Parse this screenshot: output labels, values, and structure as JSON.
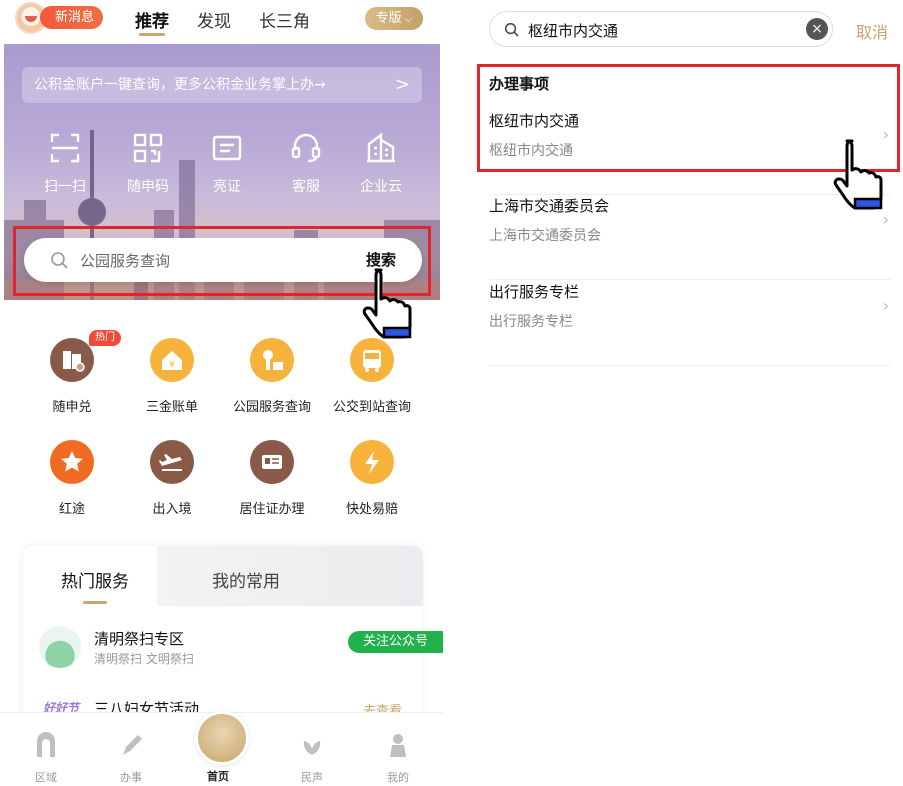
{
  "left": {
    "topbar": {
      "message_label": "新消息",
      "tabs": [
        "推荐",
        "发现",
        "长三角"
      ],
      "active_tab": "推荐",
      "edition_label": "专版"
    },
    "banner": {
      "notice_text": "公积金账户一键查询，更多公积金业务掌上办→",
      "notice_chevron": ">",
      "quick_actions": [
        {
          "label": "扫一扫",
          "icon": "scan-icon"
        },
        {
          "label": "随申码",
          "icon": "qr-code-icon"
        },
        {
          "label": "亮证",
          "icon": "id-card-icon"
        },
        {
          "label": "客服",
          "icon": "headset-icon"
        },
        {
          "label": "企业云",
          "icon": "building-icon"
        }
      ]
    },
    "search": {
      "placeholder": "公园服务查询",
      "button_label": "搜索"
    },
    "services": [
      {
        "label": "随申兑",
        "icon": "voucher-icon",
        "color": "#8a5a49",
        "badge": "热门"
      },
      {
        "label": "三金账单",
        "icon": "bill-icon",
        "color": "#f6b23a"
      },
      {
        "label": "公园服务查询",
        "icon": "park-icon",
        "color": "#f6b23a"
      },
      {
        "label": "公交到站查询",
        "icon": "bus-icon",
        "color": "#f6b23a"
      },
      {
        "label": "红途",
        "icon": "star-icon",
        "color": "#f06a22"
      },
      {
        "label": "出入境",
        "icon": "plane-icon",
        "color": "#8a5a49"
      },
      {
        "label": "居住证办理",
        "icon": "card-icon",
        "color": "#8a5a49"
      },
      {
        "label": "快处易赔",
        "icon": "lightning-icon",
        "color": "#f6b23a"
      }
    ],
    "hot_card": {
      "tabs": [
        "热门服务",
        "我的常用"
      ],
      "items": [
        {
          "title": "清明祭扫专区",
          "subtitle": "清明祭扫 文明祭扫",
          "action": "关注公众号"
        },
        {
          "title": "三八妇女节活动",
          "icon_text": "好好节",
          "action": "去查看"
        }
      ]
    },
    "bottom_nav": [
      {
        "label": "区域",
        "icon": "arch-icon"
      },
      {
        "label": "办事",
        "icon": "pen-icon"
      },
      {
        "label": "首页",
        "icon": "home-icon"
      },
      {
        "label": "民声",
        "icon": "lotus-icon"
      },
      {
        "label": "我的",
        "icon": "person-icon"
      }
    ]
  },
  "right": {
    "search_value": "枢纽市内交通",
    "cancel_label": "取消",
    "section_title": "办理事项",
    "results": [
      {
        "title": "枢纽市内交通",
        "subtitle": "枢纽市内交通"
      },
      {
        "title": "上海市交通委员会",
        "subtitle": "上海市交通委员会"
      },
      {
        "title": "出行服务专栏",
        "subtitle": "出行服务专栏"
      }
    ]
  },
  "colors": {
    "accent_gold": "#c9a66b",
    "highlight_red": "#e0262c",
    "follow_green": "#22b24c"
  }
}
